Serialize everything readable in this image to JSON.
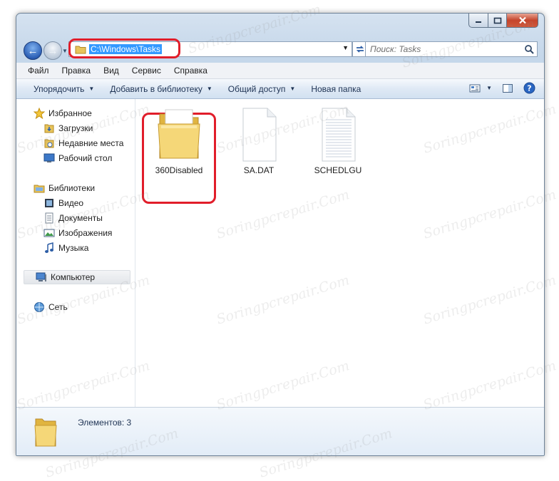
{
  "address": {
    "path": "C:\\Windows\\Tasks"
  },
  "search": {
    "placeholder": "Поиск: Tasks"
  },
  "menu": [
    "Файл",
    "Правка",
    "Вид",
    "Сервис",
    "Справка"
  ],
  "toolbar": {
    "organize": "Упорядочить",
    "add_to_library": "Добавить в библиотеку",
    "share": "Общий доступ",
    "new_folder": "Новая папка"
  },
  "nav": {
    "favorites": "Избранное",
    "downloads": "Загрузки",
    "recent": "Недавние места",
    "desktop": "Рабочий стол",
    "libraries": "Библиотеки",
    "video": "Видео",
    "documents": "Документы",
    "images": "Изображения",
    "music": "Музыка",
    "computer": "Компьютер",
    "network": "Сеть"
  },
  "files": [
    {
      "name": "360Disabled",
      "kind": "folder"
    },
    {
      "name": "SA.DAT",
      "kind": "blank-file"
    },
    {
      "name": "SCHEDLGU",
      "kind": "text-file"
    }
  ],
  "status": {
    "items": "Элементов: 3"
  },
  "watermark": "Soringpcrepair.Com",
  "colors": {
    "highlight": "#e11d2a",
    "selection": "#3399ff"
  }
}
